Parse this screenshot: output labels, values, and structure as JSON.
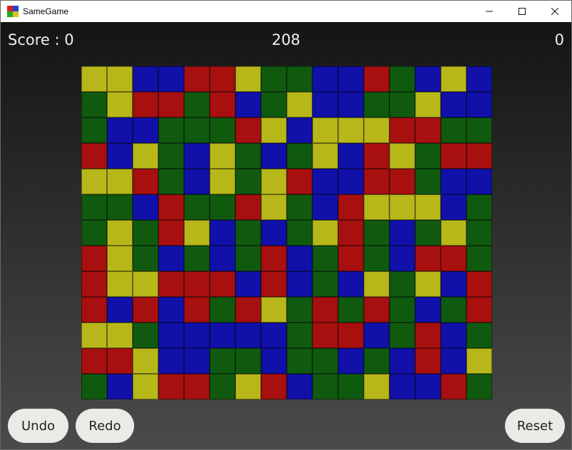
{
  "window": {
    "title": "SameGame",
    "controls": {
      "minimize": "—",
      "maximize": "☐",
      "close": "✕"
    },
    "icon_colors": [
      "#d42020",
      "#2244cc",
      "#22aa22",
      "#e0c020"
    ]
  },
  "hud": {
    "score_label": "Score :  0",
    "center_value": "208",
    "right_value": "0"
  },
  "buttons": {
    "undo": "Undo",
    "redo": "Redo",
    "reset": "Reset"
  },
  "colors": {
    "Y": "#b7b719",
    "B": "#1111aa",
    "R": "#a80f0f",
    "G": "#105a10"
  },
  "board": {
    "columns": 16,
    "rows": [
      "YYBBRRYGGBBRGBYB",
      "GYRRGRBGYBBGGYBB",
      "GBBGGGRYBYYYRRGG",
      "RBYGBYGBGYBRYGRR",
      "YYRGBYGYRBBRRGBB",
      "GGBRGGRYGBRYYYBG",
      "GYGRYBGBGYRGBGYG",
      "RYGBGBGRBGRGBRRG",
      "RYYRRRBRBGBYGYBR",
      "RBRBRGRYGRGRGBGR",
      "YYGBBBBBGRRBGRBG",
      "RRYBBGGBGGBGBRBY",
      "GBYRRGYRBGGYBBRG"
    ]
  }
}
